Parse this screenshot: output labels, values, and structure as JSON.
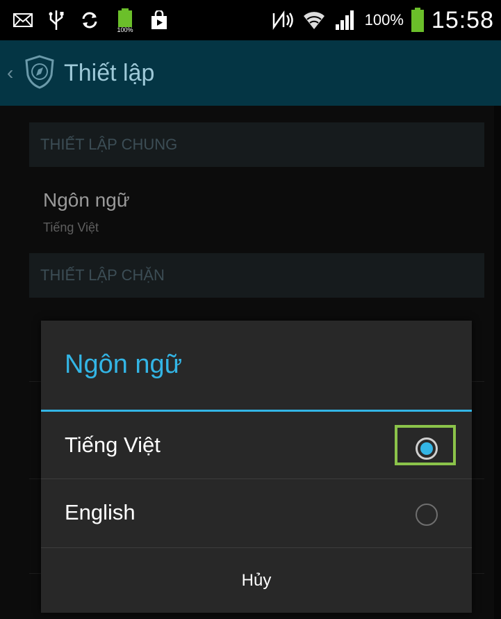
{
  "status_bar": {
    "battery_percent": "100%",
    "small_battery_label": "100%",
    "time": "15:58",
    "icons": [
      "mail-icon",
      "usb-icon",
      "sync-icon",
      "battery-icon",
      "shopping-bag-icon",
      "nfc-icon",
      "wifi-icon",
      "signal-icon",
      "battery-icon"
    ]
  },
  "action_bar": {
    "title": "Thiết lập"
  },
  "settings": {
    "general_header": "THIẾT LẬP CHUNG",
    "language_title": "Ngôn ngữ",
    "language_value": "Tiếng Việt",
    "block_header": "THIẾT LẬP CHẶN"
  },
  "dialog": {
    "title": "Ngôn ngữ",
    "options": [
      {
        "label": "Tiếng Việt",
        "selected": true
      },
      {
        "label": "English",
        "selected": false
      }
    ],
    "cancel_label": "Hủy"
  },
  "colors": {
    "accent": "#33b5e5",
    "action_bar": "#043544",
    "highlight": "#8bc34a"
  }
}
